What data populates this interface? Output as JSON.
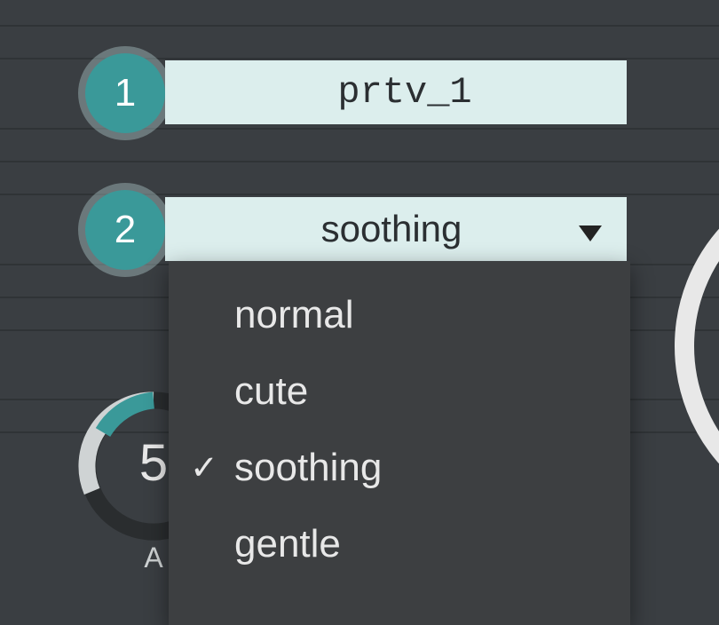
{
  "rows": {
    "r1": {
      "badge": "1",
      "input_value": "prtv_1"
    },
    "r2": {
      "badge": "2",
      "selected": "soothing"
    }
  },
  "dropdown": {
    "options": [
      "normal",
      "cute",
      "soothing",
      "gentle"
    ],
    "selected": "soothing"
  },
  "dial": {
    "value_visible": "5",
    "label_visible": "A"
  },
  "colors": {
    "bg": "#3a3e42",
    "accent": "#3a9999",
    "field_bg": "#dceeed",
    "menu_bg": "#3d3f41"
  }
}
